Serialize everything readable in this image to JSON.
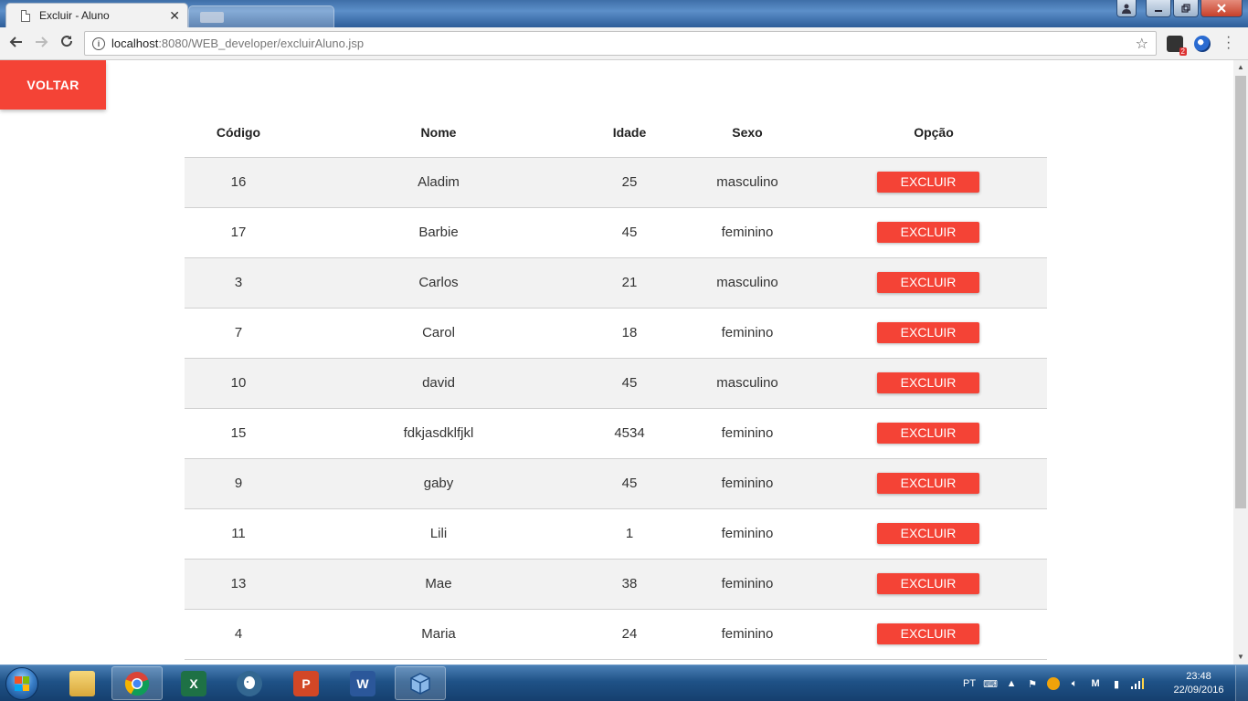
{
  "browser": {
    "tab_title": "Excluir - Aluno",
    "tab_close": "✕",
    "url_host": "localhost",
    "url_path": ":8080/WEB_developer/excluirAluno.jsp",
    "extension_badge": "2"
  },
  "page": {
    "voltar_label": "VOLTAR",
    "excluir_label": "EXCLUIR",
    "accent_color": "#f44336",
    "table": {
      "headers": [
        "Código",
        "Nome",
        "Idade",
        "Sexo",
        "Opção"
      ],
      "rows": [
        {
          "codigo": "16",
          "nome": "Aladim",
          "idade": "25",
          "sexo": "masculino"
        },
        {
          "codigo": "17",
          "nome": "Barbie",
          "idade": "45",
          "sexo": "feminino"
        },
        {
          "codigo": "3",
          "nome": "Carlos",
          "idade": "21",
          "sexo": "masculino"
        },
        {
          "codigo": "7",
          "nome": "Carol",
          "idade": "18",
          "sexo": "feminino"
        },
        {
          "codigo": "10",
          "nome": "david",
          "idade": "45",
          "sexo": "masculino"
        },
        {
          "codigo": "15",
          "nome": "fdkjasdklfjkl",
          "idade": "4534",
          "sexo": "feminino"
        },
        {
          "codigo": "9",
          "nome": "gaby",
          "idade": "45",
          "sexo": "feminino"
        },
        {
          "codigo": "11",
          "nome": "Lili",
          "idade": "1",
          "sexo": "feminino"
        },
        {
          "codigo": "13",
          "nome": "Mae",
          "idade": "38",
          "sexo": "feminino"
        },
        {
          "codigo": "4",
          "nome": "Maria",
          "idade": "24",
          "sexo": "feminino"
        }
      ]
    }
  },
  "taskbar": {
    "language": "PT",
    "time": "23:48",
    "date": "22/09/2016",
    "apps": [
      "file-explorer-icon",
      "chrome-icon",
      "excel-icon",
      "postgresql-icon",
      "powerpoint-icon",
      "word-icon",
      "virtualbox-icon"
    ]
  }
}
